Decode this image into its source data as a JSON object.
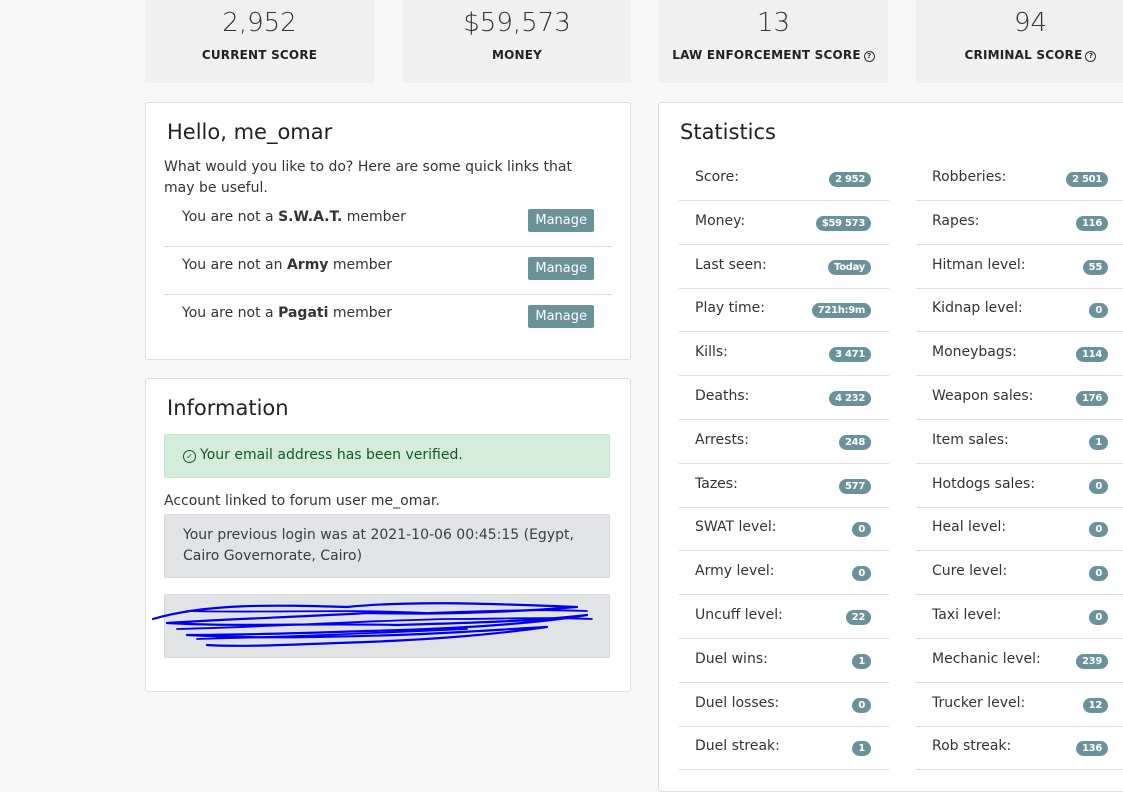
{
  "top_cards": [
    {
      "value": "2,952",
      "label": "CURRENT SCORE",
      "help": false
    },
    {
      "value": "$59,573",
      "label": "MONEY",
      "help": false
    },
    {
      "value": "13",
      "label": "LAW ENFORCEMENT SCORE",
      "help": true
    },
    {
      "value": "94",
      "label": "CRIMINAL SCORE",
      "help": true
    }
  ],
  "hello": {
    "title": "Hello, me_omar",
    "intro": "What would you like to do? Here are some quick links that may be useful.",
    "rows": [
      {
        "pre": "You are not a ",
        "group": "S.W.A.T.",
        "post": " member",
        "button": "Manage"
      },
      {
        "pre": "You are not an ",
        "group": "Army",
        "post": " member",
        "button": "Manage"
      },
      {
        "pre": "You are not a ",
        "group": "Pagati",
        "post": " member",
        "button": "Manage"
      }
    ]
  },
  "information": {
    "title": "Information",
    "verified": "Your email address has been verified.",
    "forum_link": "Account linked to forum user me_omar.",
    "previous_login": "Your previous login was at 2021-10-06 00:45:15 (Egypt, Cairo Governorate, Cairo)"
  },
  "statistics": {
    "title": "Statistics",
    "left": [
      {
        "name": "Score:",
        "value": "2 952"
      },
      {
        "name": "Money:",
        "value": "$59 573"
      },
      {
        "name": "Last seen:",
        "value": "Today"
      },
      {
        "name": "Play time:",
        "value": "721h:9m"
      },
      {
        "name": "Kills:",
        "value": "3 471"
      },
      {
        "name": "Deaths:",
        "value": "4 232"
      },
      {
        "name": "Arrests:",
        "value": "248"
      },
      {
        "name": "Tazes:",
        "value": "577"
      },
      {
        "name": "SWAT level:",
        "value": "0"
      },
      {
        "name": "Army level:",
        "value": "0"
      },
      {
        "name": "Uncuff level:",
        "value": "22"
      },
      {
        "name": "Duel wins:",
        "value": "1"
      },
      {
        "name": "Duel losses:",
        "value": "0"
      },
      {
        "name": "Duel streak:",
        "value": "1"
      }
    ],
    "right": [
      {
        "name": "Robberies:",
        "value": "2 501"
      },
      {
        "name": "Rapes:",
        "value": "116"
      },
      {
        "name": "Hitman level:",
        "value": "55"
      },
      {
        "name": "Kidnap level:",
        "value": "0"
      },
      {
        "name": "Moneybags:",
        "value": "114"
      },
      {
        "name": "Weapon sales:",
        "value": "176"
      },
      {
        "name": "Item sales:",
        "value": "1"
      },
      {
        "name": "Hotdogs sales:",
        "value": "0"
      },
      {
        "name": "Heal level:",
        "value": "0"
      },
      {
        "name": "Cure level:",
        "value": "0"
      },
      {
        "name": "Taxi level:",
        "value": "0"
      },
      {
        "name": "Mechanic level:",
        "value": "239"
      },
      {
        "name": "Trucker level:",
        "value": "12"
      },
      {
        "name": "Rob streak:",
        "value": "136"
      }
    ]
  },
  "colors": {
    "badge": "#6b929b",
    "success_bg": "#d4edda",
    "scribble": "#0000ee"
  }
}
